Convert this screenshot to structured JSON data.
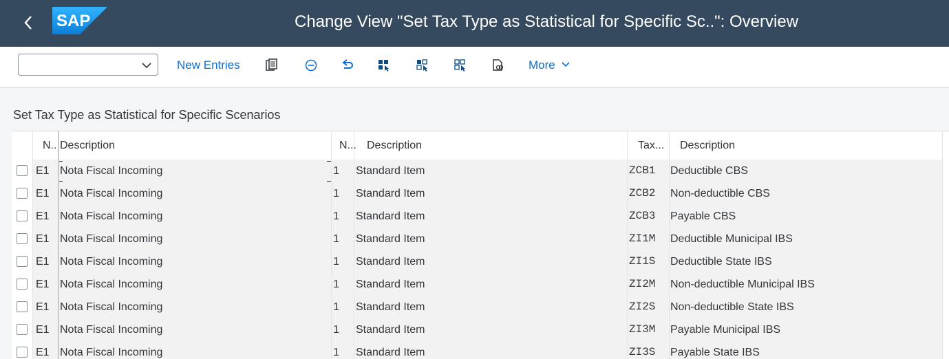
{
  "header": {
    "back_icon": "chevron-left-icon",
    "logo_text": "SAP",
    "title": "Change View \"Set Tax Type as Statistical for Specific Sc..\": Overview"
  },
  "toolbar": {
    "variant_value": "",
    "new_entries_label": "New Entries",
    "more_label": "More",
    "icons": [
      "details-icon",
      "delete-icon",
      "undo-icon",
      "select-all-icon",
      "select-block-icon",
      "deselect-all-icon",
      "print-preview-icon"
    ]
  },
  "section": {
    "title": "Set Tax Type as Statistical for Specific Scenarios"
  },
  "table": {
    "columns": [
      "N...",
      "Description",
      "N...",
      "Description",
      "Tax...",
      "Description"
    ],
    "rows": [
      {
        "n1": "E1",
        "d1": "Nota Fiscal Incoming",
        "n2": "1",
        "d2": "Standard Item",
        "tax": "ZCB1",
        "d3": "Deductible CBS"
      },
      {
        "n1": "E1",
        "d1": "Nota Fiscal Incoming",
        "n2": "1",
        "d2": "Standard Item",
        "tax": "ZCB2",
        "d3": "Non-deductible CBS"
      },
      {
        "n1": "E1",
        "d1": "Nota Fiscal Incoming",
        "n2": "1",
        "d2": "Standard Item",
        "tax": "ZCB3",
        "d3": "Payable CBS"
      },
      {
        "n1": "E1",
        "d1": "Nota Fiscal Incoming",
        "n2": "1",
        "d2": "Standard Item",
        "tax": "ZI1M",
        "d3": "Deductible Municipal IBS"
      },
      {
        "n1": "E1",
        "d1": "Nota Fiscal Incoming",
        "n2": "1",
        "d2": "Standard Item",
        "tax": "ZI1S",
        "d3": "Deductible State IBS"
      },
      {
        "n1": "E1",
        "d1": "Nota Fiscal Incoming",
        "n2": "1",
        "d2": "Standard Item",
        "tax": "ZI2M",
        "d3": "Non-deductible Municipal IBS"
      },
      {
        "n1": "E1",
        "d1": "Nota Fiscal Incoming",
        "n2": "1",
        "d2": "Standard Item",
        "tax": "ZI2S",
        "d3": "Non-deductible State IBS"
      },
      {
        "n1": "E1",
        "d1": "Nota Fiscal Incoming",
        "n2": "1",
        "d2": "Standard Item",
        "tax": "ZI3M",
        "d3": "Payable Municipal IBS"
      },
      {
        "n1": "E1",
        "d1": "Nota Fiscal Incoming",
        "n2": "1",
        "d2": "Standard Item",
        "tax": "ZI3S",
        "d3": "Payable State IBS"
      }
    ]
  },
  "colors": {
    "shell": "#354a5f",
    "link": "#0a6ed1",
    "logo_blue": "#1f9bf0"
  }
}
